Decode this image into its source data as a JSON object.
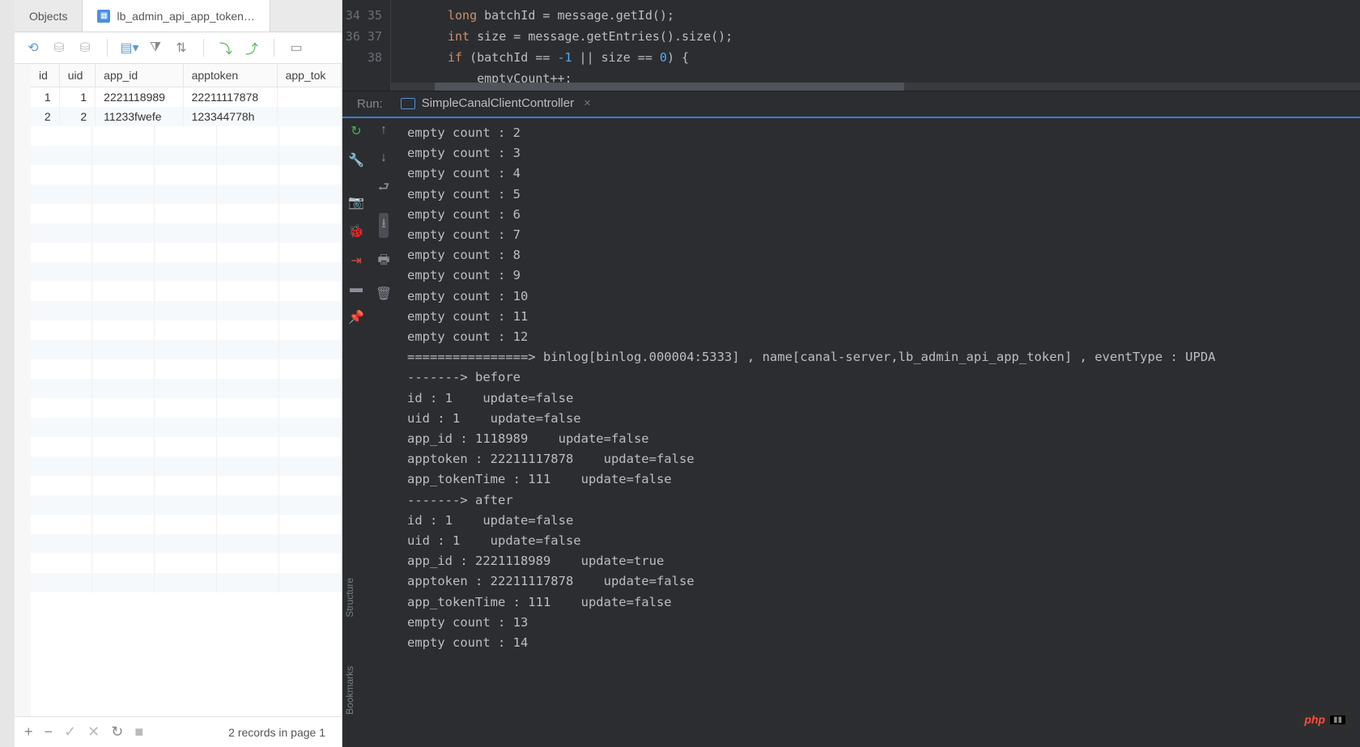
{
  "db": {
    "tabs": [
      {
        "label": "Objects"
      },
      {
        "label": "lb_admin_api_app_token…",
        "active": true
      }
    ],
    "columns": [
      "id",
      "uid",
      "app_id",
      "apptoken",
      "app_tok"
    ],
    "rows": [
      {
        "id": "1",
        "uid": "1",
        "app_id": "2221118989",
        "apptoken": "22211117878",
        "app_tok": ""
      },
      {
        "id": "2",
        "uid": "2",
        "app_id": "11233fwefe",
        "apptoken": "123344778h",
        "app_tok": ""
      }
    ],
    "footer_status": "2 records in page 1"
  },
  "editor": {
    "line_start": 34,
    "lines": [
      {
        "html": "<span class='kw'>long</span> batchId = message.getId();"
      },
      {
        "html": "<span class='kw'>int</span> size = message.getEntries().size();"
      },
      {
        "html": "<span class='kw'>if</span> (batchId == <span class='num'>-1</span> || size == <span class='num'>0</span>) {"
      },
      {
        "html": "    <span class='under'>emptyCount</span>++;"
      }
    ]
  },
  "run": {
    "label": "Run:",
    "tab": "SimpleCanalClientController",
    "console": [
      "empty count : 2",
      "empty count : 3",
      "empty count : 4",
      "empty count : 5",
      "empty count : 6",
      "empty count : 7",
      "empty count : 8",
      "empty count : 9",
      "empty count : 10",
      "empty count : 11",
      "empty count : 12",
      "================> binlog[binlog.000004:5333] , name[canal-server,lb_admin_api_app_token] , eventType : UPDA",
      "-------> before",
      "id : 1    update=false",
      "uid : 1    update=false",
      "app_id : 1118989    update=false",
      "apptoken : 22211117878    update=false",
      "app_tokenTime : 111    update=false",
      "-------> after",
      "id : 1    update=false",
      "uid : 1    update=false",
      "app_id : 2221118989    update=true",
      "apptoken : 22211117878    update=false",
      "app_tokenTime : 111    update=false",
      "empty count : 13",
      "empty count : 14"
    ]
  },
  "sidebar_vertical": {
    "structure": "Structure",
    "bookmarks": "Bookmarks"
  },
  "badge": {
    "text": "php"
  }
}
